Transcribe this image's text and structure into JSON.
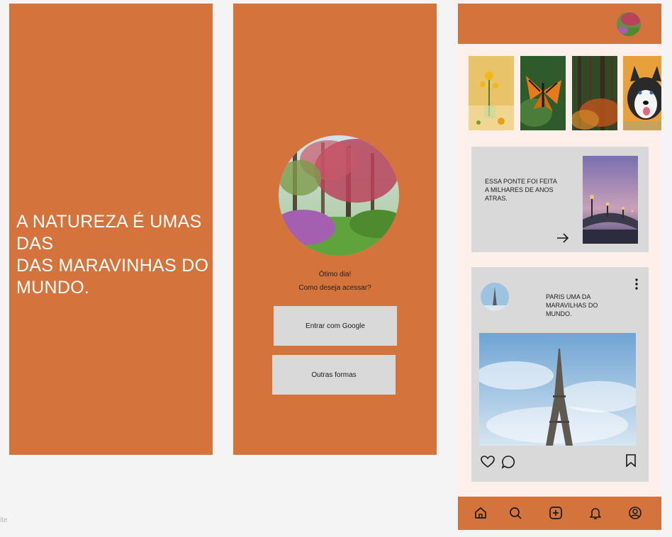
{
  "screen1": {
    "headline": "A NATUREZA É UMAS DAS\nDAS MARAVINHAS DO\nMUNDO."
  },
  "screen2": {
    "greeting": "Ótimo dia!",
    "question": "Como deseja acessar?",
    "google_button": "Entrar com Google",
    "other_button": "Outras formas"
  },
  "screen3": {
    "card1_text": "ESSA PONTE FOI FEITA\nA MILHARES DE ANOS\nATRAS.",
    "card2_text": "PARIS UMA DA\nMARAVILHAS DO\nMUNDO.",
    "stories": [
      "yellow-flowers",
      "butterfly",
      "forest",
      "husky"
    ],
    "nav": [
      "home-icon",
      "search-icon",
      "add-icon",
      "bell-icon",
      "profile-icon"
    ]
  },
  "colors": {
    "accent": "#d5733c",
    "card": "#d9d9d9",
    "feed_bg": "#fdf0ea"
  },
  "corner_label": "ite"
}
